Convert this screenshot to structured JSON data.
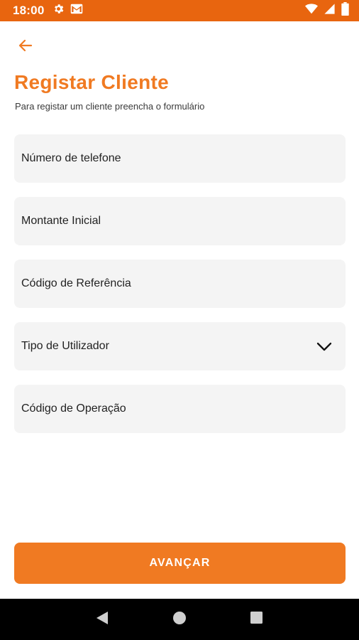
{
  "status_bar": {
    "time": "18:00",
    "icons_left": [
      "gear-icon",
      "gmail-icon"
    ],
    "icons_right": [
      "wifi-icon",
      "signal-icon",
      "battery-icon"
    ],
    "color": "#e8650f"
  },
  "header": {
    "back_icon": "arrow-left-icon",
    "title": "Registar Cliente",
    "subtitle": "Para registar um cliente preencha o formulário"
  },
  "form": {
    "fields": [
      {
        "label": "Número de telefone",
        "type": "text"
      },
      {
        "label": "Montante Inicial",
        "type": "text"
      },
      {
        "label": "Código de Referência",
        "type": "text"
      },
      {
        "label": "Tipo de Utilizador",
        "type": "select",
        "icon": "chevron-down-icon"
      },
      {
        "label": "Código de Operação",
        "type": "text"
      }
    ]
  },
  "submit": {
    "label": "AVANÇAR"
  },
  "nav_bar": {
    "buttons": [
      "back-triangle-icon",
      "home-circle-icon",
      "recents-square-icon"
    ]
  },
  "colors": {
    "accent": "#f07a22",
    "field_bg": "#f4f4f4"
  }
}
